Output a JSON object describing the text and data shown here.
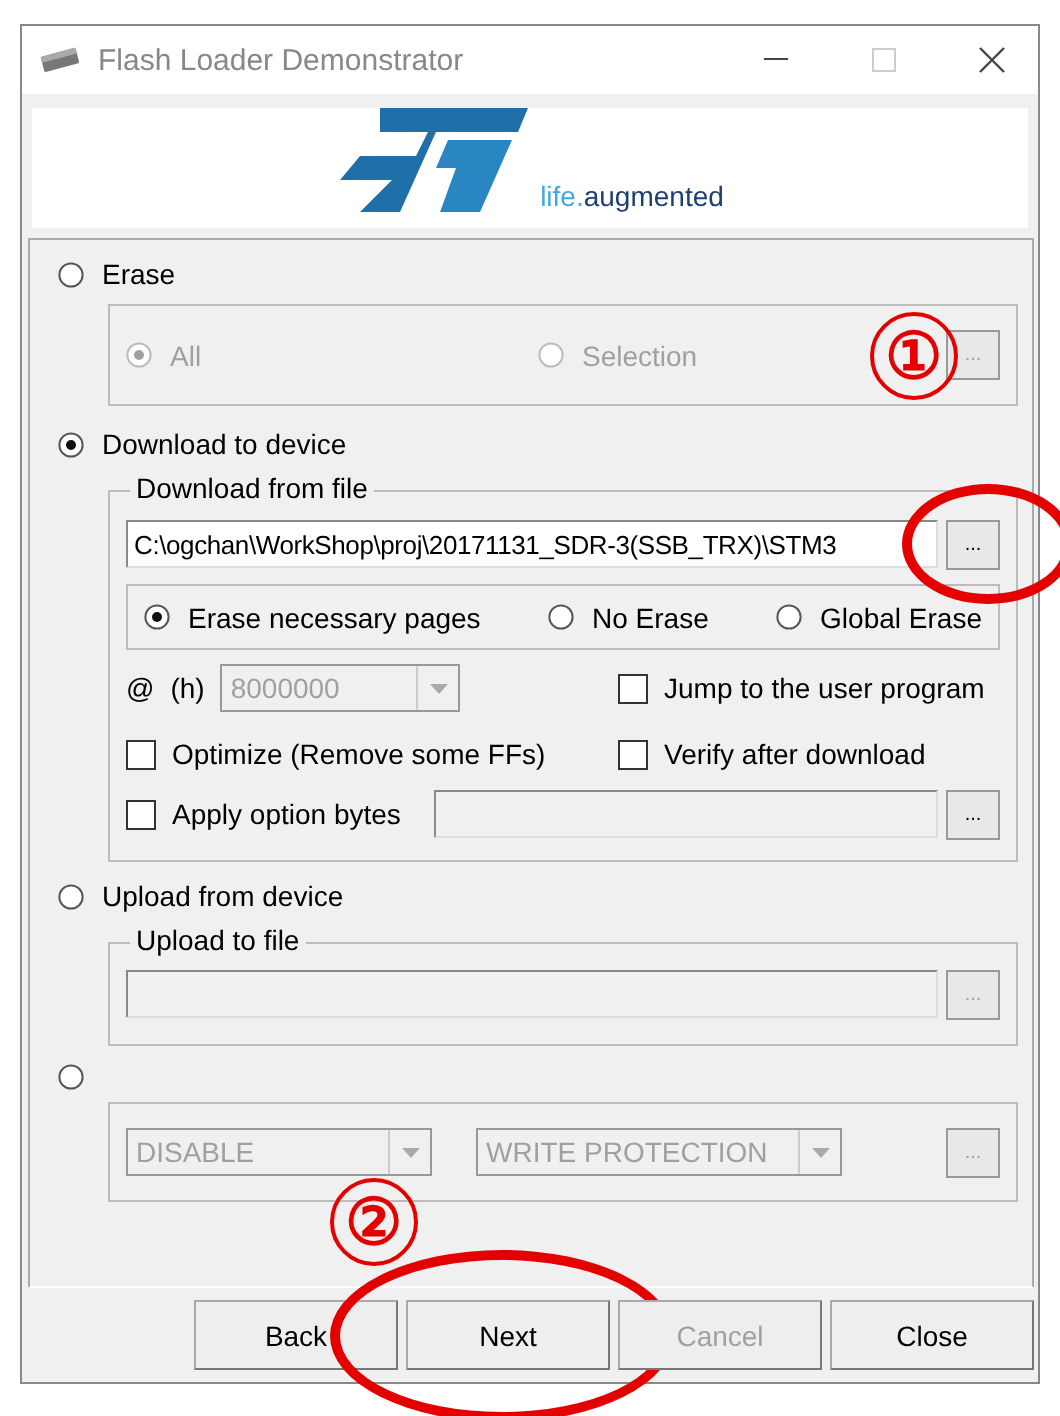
{
  "window": {
    "title": "Flash Loader Demonstrator"
  },
  "logo": {
    "tagline_light": "life.",
    "tagline_dark": "augmented"
  },
  "options": [
    {
      "kind": "erase",
      "label": "Erase",
      "selected": false,
      "marker": "①",
      "browse": "...",
      "choices": [
        {
          "label": "All",
          "selected": true
        },
        {
          "label": "Selection",
          "selected": false
        }
      ]
    },
    {
      "kind": "download",
      "label": "Download to device",
      "selected": true,
      "group_title": "Download from file",
      "file_path": "C:\\ogchan\\WorkShop\\proj\\20171131_SDR-3(SSB_TRX)\\STM3",
      "browse": "...",
      "browse_circled": true,
      "erase_modes": [
        {
          "label": "Erase necessary pages",
          "selected": true
        },
        {
          "label": "No Erase",
          "selected": false
        },
        {
          "label": "Global Erase",
          "selected": false
        }
      ],
      "address_prefix": "@",
      "address_unit": "(h)",
      "address": "8000000",
      "checks": [
        {
          "label": "Jump to the user program",
          "checked": false
        },
        {
          "label": "Optimize (Remove some FFs)",
          "checked": false
        },
        {
          "label": "Verify after download",
          "checked": false
        }
      ],
      "option_bytes": {
        "label": "Apply option bytes",
        "checked": false,
        "browse": "..."
      }
    },
    {
      "kind": "upload",
      "label": "Upload from device",
      "selected": false,
      "group_title": "Upload to file",
      "browse": "..."
    },
    {
      "kind": "protection",
      "selected": false,
      "marker": "②",
      "browse": "...",
      "mode": "DISABLE",
      "target": "WRITE PROTECTION"
    }
  ],
  "buttons": [
    {
      "label": "Back",
      "disabled": false,
      "circled": false
    },
    {
      "label": "Next",
      "disabled": false,
      "circled": true
    },
    {
      "label": "Cancel",
      "disabled": true,
      "circled": false
    },
    {
      "label": "Close",
      "disabled": false,
      "circled": false
    }
  ]
}
